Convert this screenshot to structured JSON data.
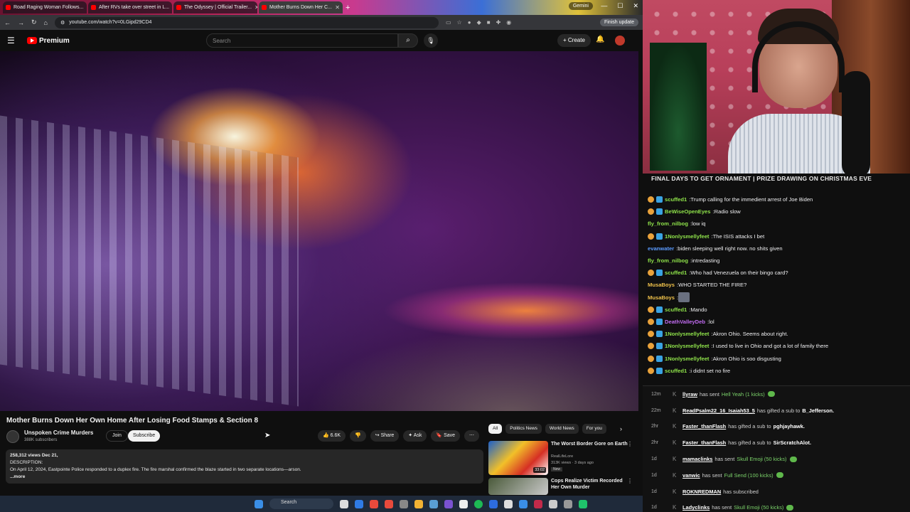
{
  "browser": {
    "tabs": [
      {
        "title": "Road Raging Woman Follows..."
      },
      {
        "title": "After RVs take over street in L..."
      },
      {
        "title": "The Odyssey | Official Trailer..."
      },
      {
        "title": "Mother Burns Down Her C..."
      }
    ],
    "gemini_label": "Gemini",
    "url": "youtube.com/watch?v=0LGipd29CD4",
    "finish_update": "Finish update"
  },
  "youtube": {
    "logo_text": "Premium",
    "search_placeholder": "Search",
    "create_label": "Create",
    "video": {
      "title": "Mother Burns Down Her Own Home After Losing Food Stamps & Section 8",
      "channel": "Unspoken Crime Murders",
      "subscribers": "388K subscribers",
      "join": "Join",
      "subscribe": "Subscribe",
      "likes": "6.6K",
      "share": "Share",
      "ask": "Ask",
      "save": "Save",
      "views_date": "258,312 views  Dec 21,",
      "desc_label": "DESCRIPTION:",
      "desc_text": "On April 12, 2024, Eastpointe Police responded to a duplex fire. The fire marshal confirmed the blaze started in two separate locations—arson.",
      "more": "...more"
    },
    "chips": [
      "All",
      "Politics News",
      "World News",
      "For you"
    ],
    "related": [
      {
        "title": "The Worst Border Gore on Earth",
        "channel": "RealLifeLore",
        "views": "313K views · 3 days ago",
        "badge": "New",
        "duration": "33:02"
      },
      {
        "title": "Cops Realize Victim Recorded Her Own Murder",
        "channel": "",
        "views": "",
        "badge": "",
        "duration": ""
      }
    ]
  },
  "stream": {
    "banner": "FINAL DAYS TO GET ORNAMENT | PRIZE DRAWING ON CHRISTMAS EVE",
    "chat": [
      {
        "user": "scuffed1",
        "color": "#8fe34a",
        "badges": 2,
        "text": "Trump calling for the immedient arrest of Joe Biden"
      },
      {
        "user": "BeWiseOpenEyes",
        "color": "#8fe34a",
        "badges": 2,
        "text": "Radio slow"
      },
      {
        "user": "fly_from_nilbog",
        "color": "#8fe34a",
        "badges": 0,
        "text": "low iq"
      },
      {
        "user": "1Nonlysmellyfeet",
        "color": "#8fe34a",
        "badges": 2,
        "text": "The ISIS attacks I bet"
      },
      {
        "user": "evanwater",
        "color": "#5b9bff",
        "badges": 0,
        "text": "biden sleeping well right now. no shits given"
      },
      {
        "user": "fly_from_nilbog",
        "color": "#8fe34a",
        "badges": 0,
        "text": "intredasting"
      },
      {
        "user": "scuffed1",
        "color": "#8fe34a",
        "badges": 2,
        "text": "Who had Venezuela on their bingo card?"
      },
      {
        "user": "MusaBoys",
        "color": "#f0c24b",
        "badges": 0,
        "text": "WHO STARTED THE FIRE?"
      },
      {
        "user": "MusaBoys",
        "color": "#f0c24b",
        "badges": 0,
        "text": "",
        "emote": true
      },
      {
        "user": "scuffed1",
        "color": "#8fe34a",
        "badges": 2,
        "text": "Mando"
      },
      {
        "user": "DeathValleyDeb",
        "color": "#c26cf2",
        "badges": 2,
        "text": "lol"
      },
      {
        "user": "1Nonlysmellyfeet",
        "color": "#8fe34a",
        "badges": 2,
        "text": "Akron Ohio. Seems about right."
      },
      {
        "user": "1Nonlysmellyfeet",
        "color": "#8fe34a",
        "badges": 2,
        "text": "I used to live in Ohio and got a lot of family there"
      },
      {
        "user": "1Nonlysmellyfeet",
        "color": "#8fe34a",
        "badges": 2,
        "text": "Akron Ohio is soo disgusting"
      },
      {
        "user": "scuffed1",
        "color": "#8fe34a",
        "badges": 2,
        "text": "i didnt set no fire"
      }
    ],
    "events": [
      {
        "time": "12m",
        "name": "llyraw",
        "action": "has sent",
        "gift": "Hell Yeah (1 kicks)",
        "target": "",
        "icon": true
      },
      {
        "time": "22m",
        "name": "ReadPsalm22_16_Isaiah53_5",
        "action": "has gifted a sub to",
        "gift": "",
        "target": "B_Jefferson.",
        "icon": false
      },
      {
        "time": "2hr",
        "name": "Faster_thanFlash",
        "action": "has gifted a sub to",
        "gift": "",
        "target": "pghjayhawk.",
        "icon": false
      },
      {
        "time": "2hr",
        "name": "Faster_thanFlash",
        "action": "has gifted a sub to",
        "gift": "",
        "target": "SirScratchAlot.",
        "icon": false
      },
      {
        "time": "1d",
        "name": "mamaclinks",
        "action": "has sent",
        "gift": "Skull Emoji (50 kicks)",
        "target": "",
        "icon": true
      },
      {
        "time": "1d",
        "name": "vanwic",
        "action": "has sent",
        "gift": "Full Send (100 kicks)",
        "target": "",
        "icon": true
      },
      {
        "time": "1d",
        "name": "ROKNREDMAN",
        "action": "has subscribed",
        "gift": "",
        "target": "",
        "icon": false
      },
      {
        "time": "1d",
        "name": "Ladyclinks",
        "action": "has sent",
        "gift": "Skull Emoji (50 kicks)",
        "target": "",
        "icon": true
      }
    ]
  },
  "taskbar": {
    "search": "Search"
  }
}
